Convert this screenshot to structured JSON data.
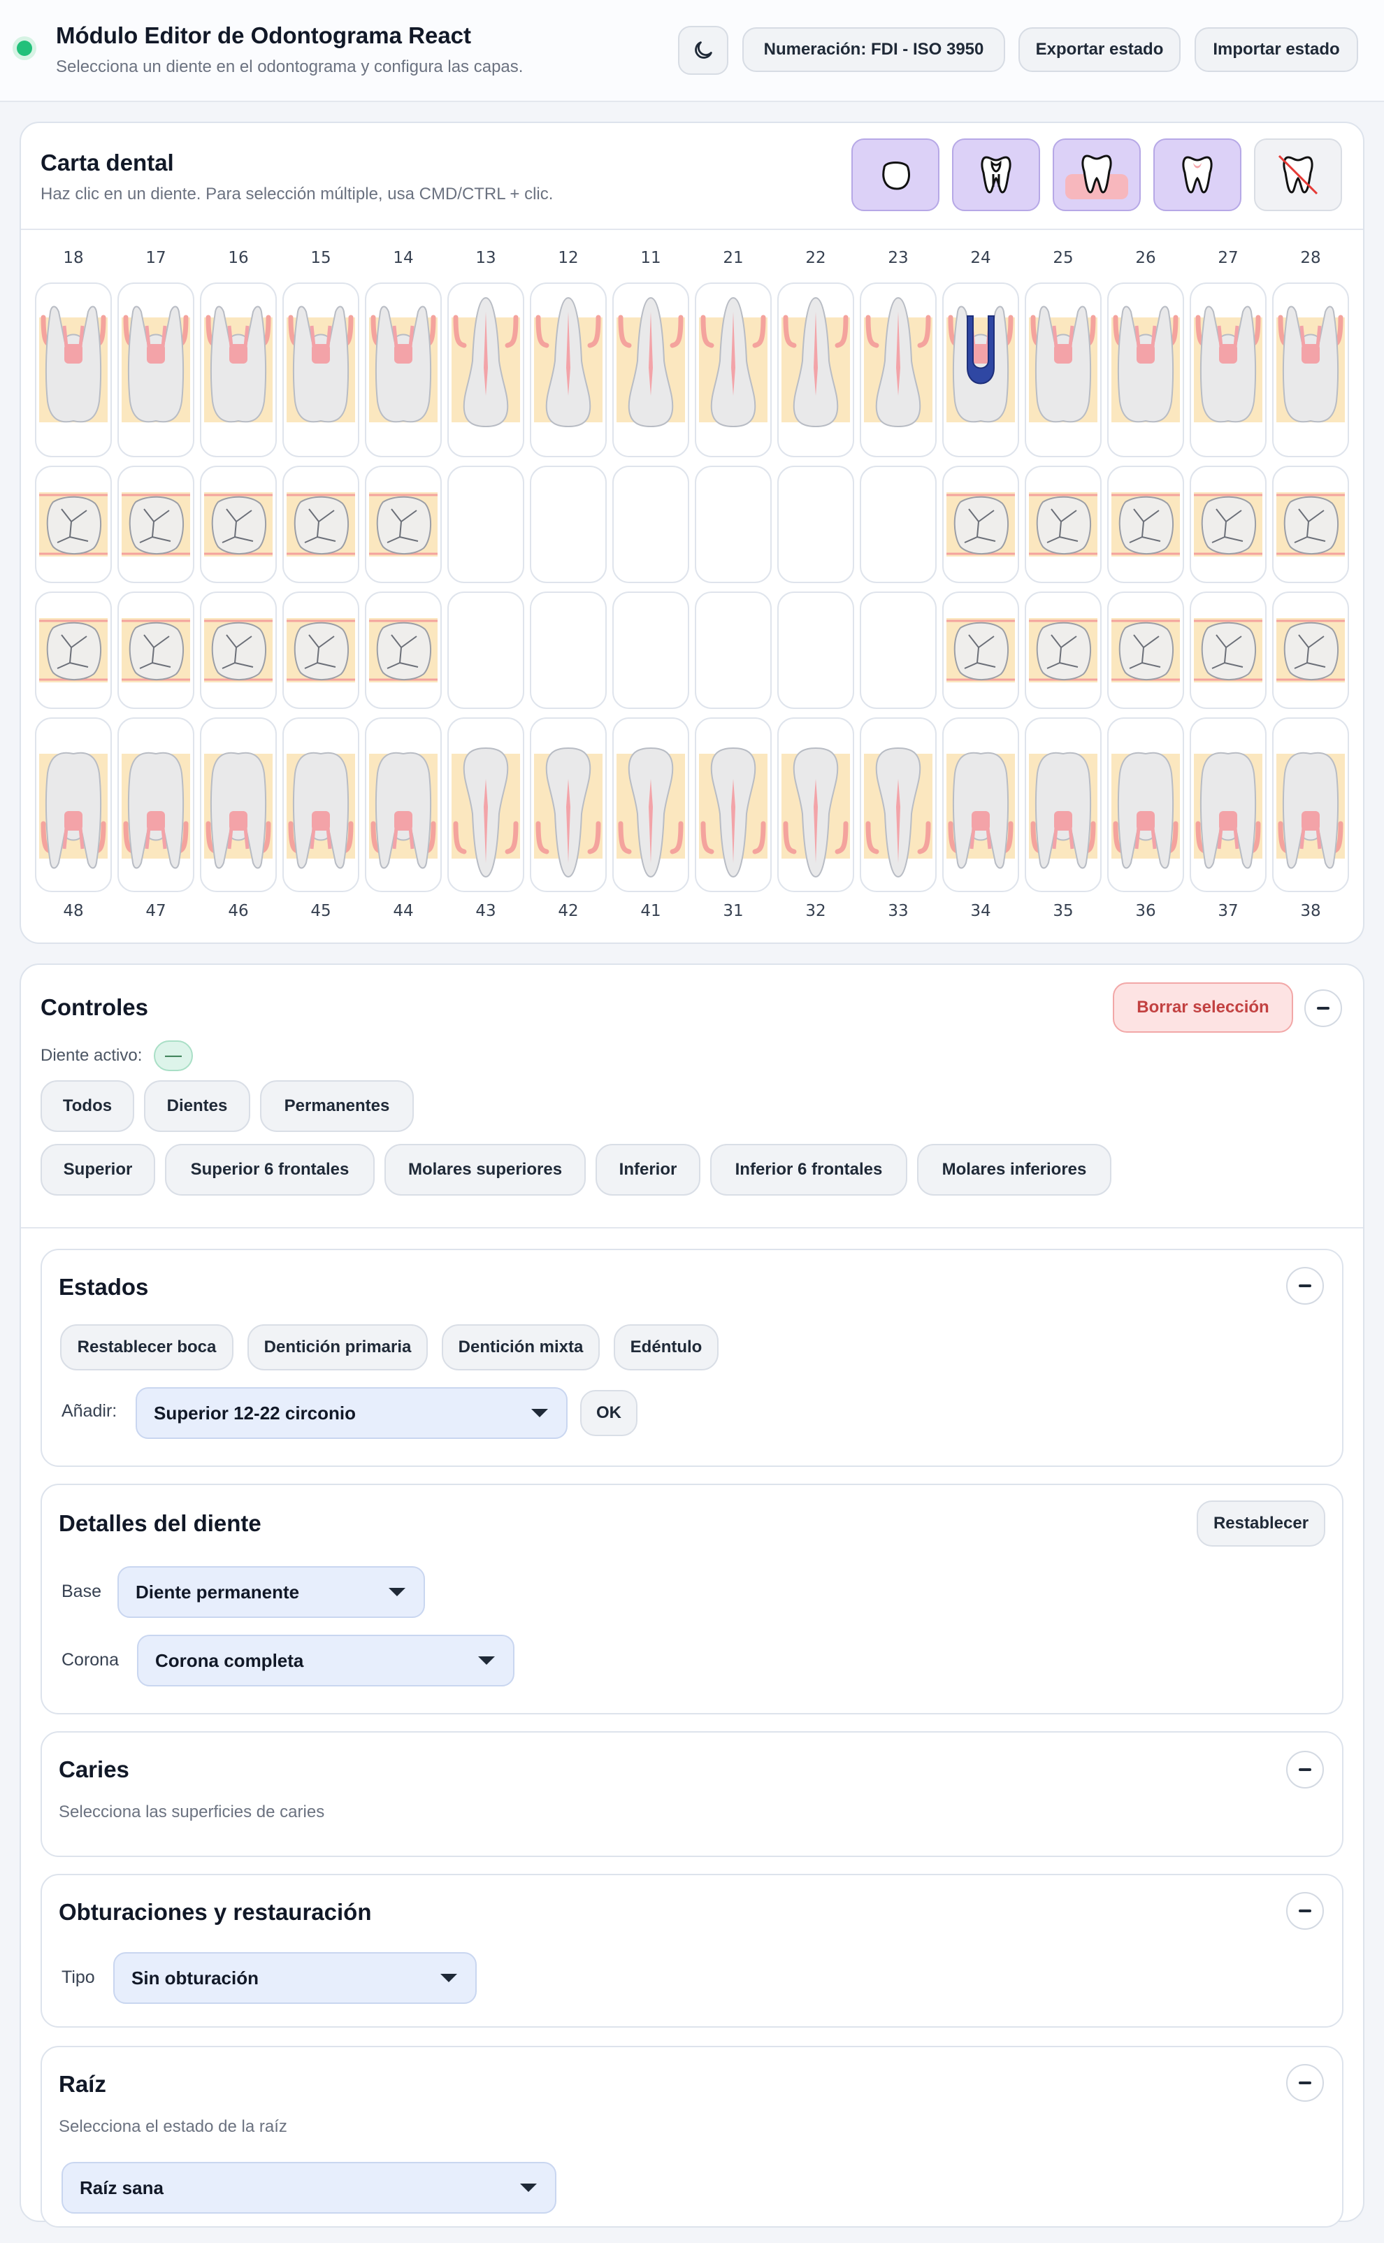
{
  "header": {
    "title": "Módulo Editor de Odontograma React",
    "subtitle": "Selecciona un diente en el odontograma y configura las capas.",
    "theme_icon": "moon-icon",
    "numbering_label": "Numeración: FDI - ISO 3950",
    "export_label": "Exportar estado",
    "import_label": "Importar estado",
    "status_color": "#22c07a"
  },
  "chart": {
    "title": "Carta dental",
    "hint": "Haz clic en un diente. Para selección múltiple, usa CMD/CTRL + clic.",
    "layer_buttons": [
      {
        "icon": "crown-outline-icon",
        "active": true
      },
      {
        "icon": "tooth-pulp-icon",
        "active": true
      },
      {
        "icon": "tooth-gum-icon",
        "active": true
      },
      {
        "icon": "tooth-icon",
        "active": true
      },
      {
        "icon": "tooth-missing-icon",
        "active": false
      }
    ],
    "upper_numbers": [
      "18",
      "17",
      "16",
      "15",
      "14",
      "13",
      "12",
      "11",
      "21",
      "22",
      "23",
      "24",
      "25",
      "26",
      "27",
      "28"
    ],
    "lower_numbers": [
      "48",
      "47",
      "46",
      "45",
      "44",
      "43",
      "42",
      "41",
      "31",
      "32",
      "33",
      "34",
      "35",
      "36",
      "37",
      "38"
    ],
    "highlighted_tooth": "24",
    "colors": {
      "bone": "#fbe7bf",
      "gum": "#f4a39d",
      "pulp": "#f3a3a8",
      "tooth": "#e9e9ea",
      "filling": "#2f47a3"
    }
  },
  "controls": {
    "title": "Controles",
    "clear_label": "Borrar selección",
    "active_label": "Diente activo:",
    "active_value": "—",
    "quick_row1": [
      "Todos",
      "Dientes",
      "Permanentes"
    ],
    "quick_row2": [
      "Superior",
      "Superior 6 frontales",
      "Molares superiores",
      "Inferior",
      "Inferior 6 frontales",
      "Molares inferiores"
    ]
  },
  "estados": {
    "title": "Estados",
    "buttons": [
      "Restablecer boca",
      "Dentición primaria",
      "Dentición mixta",
      "Edéntulo"
    ],
    "add_label": "Añadir:",
    "add_value": "Superior 12-22 circonio",
    "ok_label": "OK"
  },
  "detalles": {
    "title": "Detalles del diente",
    "reset_label": "Restablecer",
    "base_label": "Base",
    "base_value": "Diente permanente",
    "corona_label": "Corona",
    "corona_value": "Corona completa"
  },
  "caries": {
    "title": "Caries",
    "subtitle": "Selecciona las superficies de caries"
  },
  "obturaciones": {
    "title": "Obturaciones y restauración",
    "tipo_label": "Tipo",
    "tipo_value": "Sin obturación"
  },
  "raiz": {
    "title": "Raíz",
    "subtitle": "Selecciona el estado de la raíz",
    "value": "Raíz sana"
  }
}
